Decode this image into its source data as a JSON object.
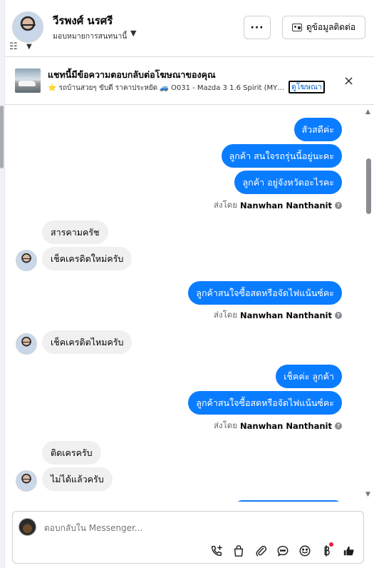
{
  "header": {
    "name": "วีรพงศ์ นรศรี",
    "subtitle": "มอบหมายการสนทนานี้",
    "more_label": "···",
    "contact_label": "ดูข้อมูลติดต่อ"
  },
  "ad": {
    "title": "แชทนี้มีข้อความตอบกลับต่อโฆษณาของคุณ",
    "description": "⭐ รถบ้านสวยๆ ขับดี ราคาประหยัด 🚙 O031 - Mazda 3 1.6 Spirit (MY1...",
    "link_label": "ดูโฆษณา",
    "close_label": "×"
  },
  "messages": [
    {
      "direction": "out",
      "text": "สัวสดีค่ะ"
    },
    {
      "direction": "out",
      "text": "ลูกค้า  สนใจรถรุ่นนี้อยู่นะคะ"
    },
    {
      "direction": "out",
      "text": "ลูกค้า อยู่จังหวัดอะไรคะ"
    },
    {
      "direction": "sent_by",
      "prefix": "ส่งโดย",
      "sender": "Nanwhan Nanthanit"
    },
    {
      "direction": "in",
      "text": "สารคามครัช"
    },
    {
      "direction": "in",
      "text": "เช็คเครดิตใหม่ครับ"
    },
    {
      "direction": "out",
      "text": "ลูกค้าสนใจซื้อสดหรือจัดไฟแน้นซ์คะ"
    },
    {
      "direction": "sent_by",
      "prefix": "ส่งโดย",
      "sender": "Nanwhan Nanthanit"
    },
    {
      "direction": "in",
      "text": "เช็คเครดิตไหมครับ"
    },
    {
      "direction": "out",
      "text": "เช็คค่ะ  ลูกค้า"
    },
    {
      "direction": "out",
      "text": "ลูกค้าสนใจซื้อสดหรือจัดไฟแน้นซ์คะ"
    },
    {
      "direction": "sent_by",
      "prefix": "ส่งโดย",
      "sender": "Nanwhan Nanthanit"
    },
    {
      "direction": "in",
      "text": "ติดเครครับ"
    },
    {
      "direction": "in",
      "text": "ไม่ได้แล้วครับ"
    }
  ],
  "composer": {
    "placeholder": "ตอบกลับใน Messenger..."
  },
  "tools": [
    "call-add-icon",
    "shopping-bag-icon",
    "paperclip-icon",
    "chat-bubble-icon",
    "emoji-icon",
    "baht-payment-icon",
    "thumbs-up-icon"
  ],
  "colors": {
    "outgoing_bubble": "#0a7cff",
    "incoming_bubble": "#f0f0f0",
    "link": "#0064d1",
    "notification_dot": "#e41e3f"
  }
}
